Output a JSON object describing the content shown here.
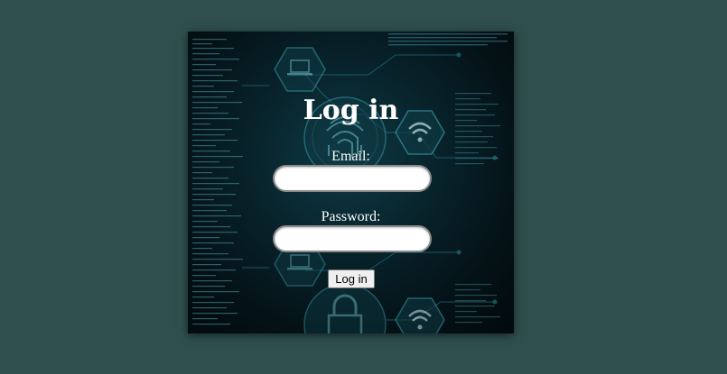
{
  "colors": {
    "page_background": "#2f4f4f",
    "card_background": "#06202a",
    "text": "#ffffff",
    "button_background": "#efefef"
  },
  "login": {
    "title": "Log in",
    "email_label": "Email:",
    "email_value": "",
    "password_label": "Password:",
    "password_value": "",
    "submit_label": "Log in"
  },
  "background_icons": [
    "laptop-icon",
    "fingerprint-icon",
    "wifi-icon",
    "padlock-icon",
    "circuit-lines"
  ]
}
